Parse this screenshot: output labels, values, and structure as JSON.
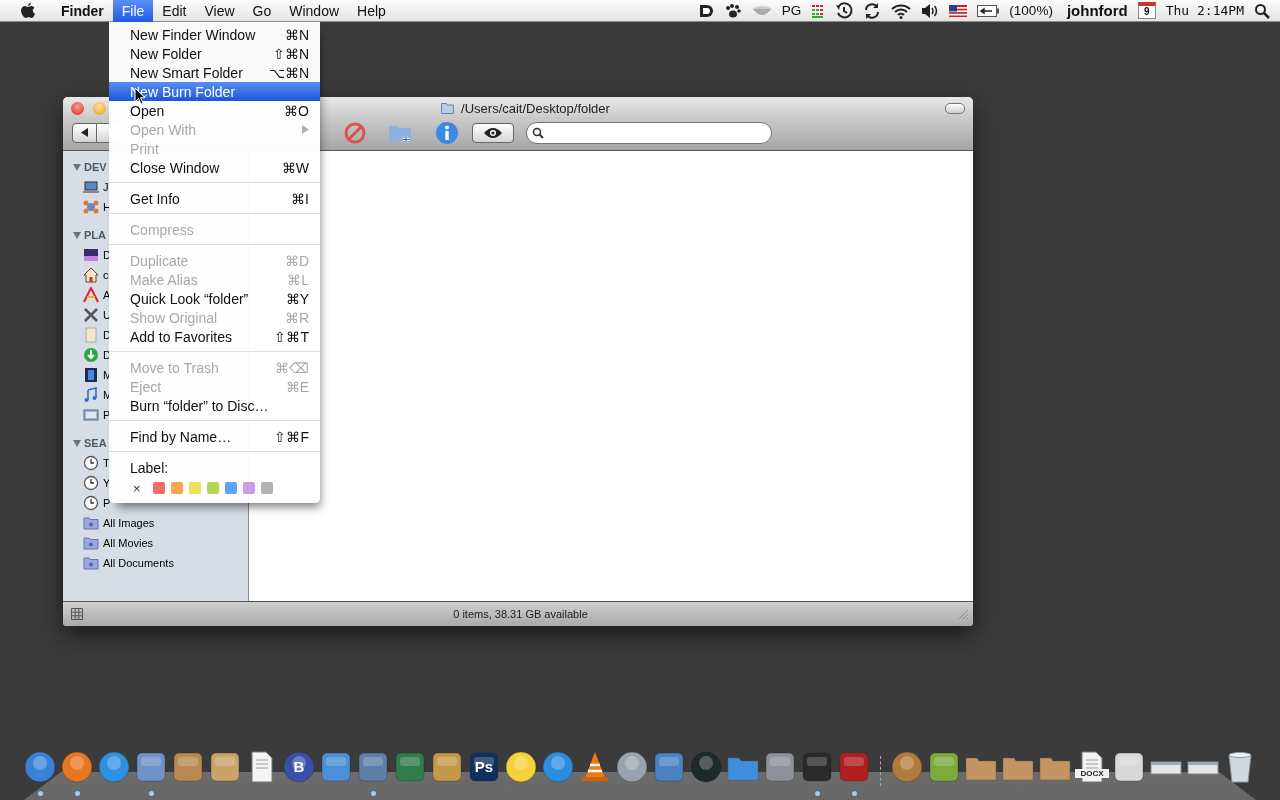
{
  "menubar": {
    "app": "Finder",
    "menus": [
      {
        "label": "File",
        "selected": true
      },
      {
        "label": "Edit",
        "selected": false
      },
      {
        "label": "View",
        "selected": false
      },
      {
        "label": "Go",
        "selected": false
      },
      {
        "label": "Window",
        "selected": false
      },
      {
        "label": "Help",
        "selected": false
      }
    ],
    "status_text": "PG",
    "battery": "(100%)",
    "user": "johnford",
    "calendar_day": "9",
    "clock": "Thu 2:14PM"
  },
  "file_menu": {
    "items": [
      {
        "kind": "item",
        "label": "New Finder Window",
        "shortcut": "⌘N",
        "disabled": false,
        "selected": false
      },
      {
        "kind": "item",
        "label": "New Folder",
        "shortcut": "⇧⌘N",
        "disabled": false,
        "selected": false
      },
      {
        "kind": "item",
        "label": "New Smart Folder",
        "shortcut": "⌥⌘N",
        "disabled": false,
        "selected": false
      },
      {
        "kind": "item",
        "label": "New Burn Folder",
        "disabled": false,
        "selected": true
      },
      {
        "kind": "item",
        "label": "Open",
        "shortcut": "⌘O",
        "disabled": false,
        "selected": false
      },
      {
        "kind": "submenu",
        "label": "Open With",
        "disabled": true,
        "selected": false
      },
      {
        "kind": "item",
        "label": "Print",
        "disabled": true,
        "selected": false
      },
      {
        "kind": "item",
        "label": "Close Window",
        "shortcut": "⌘W",
        "disabled": false,
        "selected": false
      },
      {
        "kind": "separator"
      },
      {
        "kind": "item",
        "label": "Get Info",
        "shortcut": "⌘I",
        "disabled": false,
        "selected": false
      },
      {
        "kind": "separator"
      },
      {
        "kind": "item",
        "label": "Compress",
        "disabled": true,
        "selected": false
      },
      {
        "kind": "separator"
      },
      {
        "kind": "item",
        "label": "Duplicate",
        "shortcut": "⌘D",
        "disabled": true,
        "selected": false
      },
      {
        "kind": "item",
        "label": "Make Alias",
        "shortcut": "⌘L",
        "disabled": true,
        "selected": false
      },
      {
        "kind": "item",
        "label": "Quick Look “folder”",
        "shortcut": "⌘Y",
        "disabled": false,
        "selected": false
      },
      {
        "kind": "item",
        "label": "Show Original",
        "shortcut": "⌘R",
        "disabled": true,
        "selected": false
      },
      {
        "kind": "item",
        "label": "Add to Favorites",
        "shortcut": "⇧⌘T",
        "disabled": false,
        "selected": false
      },
      {
        "kind": "separator"
      },
      {
        "kind": "item",
        "label": "Move to Trash",
        "shortcut": "⌘⌫",
        "disabled": true,
        "selected": false
      },
      {
        "kind": "item",
        "label": "Eject",
        "shortcut": "⌘E",
        "disabled": true,
        "selected": false
      },
      {
        "kind": "item",
        "label": "Burn “folder” to Disc…",
        "disabled": false,
        "selected": false
      },
      {
        "kind": "separator"
      },
      {
        "kind": "item",
        "label": "Find by Name…",
        "shortcut": "⇧⌘F",
        "disabled": false,
        "selected": false
      },
      {
        "kind": "separator"
      },
      {
        "kind": "heading",
        "label": "Label:"
      },
      {
        "kind": "labels",
        "clear": "×",
        "colors": [
          {
            "color": "#f26d6a"
          },
          {
            "color": "#f5a750"
          },
          {
            "color": "#f2de5a"
          },
          {
            "color": "#b1d855"
          },
          {
            "color": "#5ea3f4"
          },
          {
            "color": "#c99be4"
          },
          {
            "color": "#b3b3b3"
          }
        ]
      }
    ]
  },
  "window": {
    "title": "/Users/cait/Desktop/folder",
    "status": "0 items, 38.31 GB available",
    "sidebar": [
      {
        "heading": "DEV",
        "items": [
          {
            "label": "J"
          },
          {
            "label": "H"
          }
        ]
      },
      {
        "heading": "PLA",
        "items": [
          {
            "label": "D"
          },
          {
            "label": "c"
          },
          {
            "label": "A"
          },
          {
            "label": "U"
          },
          {
            "label": "D"
          },
          {
            "label": "D"
          },
          {
            "label": "M"
          },
          {
            "label": "M"
          },
          {
            "label": "P"
          }
        ]
      },
      {
        "heading": "SEA",
        "items": [
          {
            "label": "T"
          },
          {
            "label": "Y"
          },
          {
            "label": "P"
          },
          {
            "label": "All Images"
          },
          {
            "label": "All Movies"
          },
          {
            "label": "All Documents"
          }
        ]
      }
    ]
  },
  "dock": {
    "items": [
      {
        "running": true
      },
      {
        "running": true
      },
      {
        "running": false
      },
      {
        "running": true
      },
      {
        "running": false
      },
      {
        "running": false
      },
      {
        "running": false
      },
      {
        "glyph": "B",
        "running": false
      },
      {
        "running": false
      },
      {
        "running": true
      },
      {
        "running": false
      },
      {
        "running": false
      },
      {
        "glyph": "Ps",
        "running": false
      },
      {
        "running": false
      },
      {
        "running": false
      },
      {
        "running": false
      },
      {
        "running": false
      },
      {
        "running": false
      },
      {
        "running": false
      },
      {
        "running": false
      },
      {
        "running": false
      },
      {
        "running": true
      },
      {
        "running": true
      },
      {
        "running": false
      },
      {
        "running": false
      },
      {
        "running": false
      },
      {
        "running": false
      },
      {
        "running": false
      },
      {
        "glyph": "DOCX",
        "running": false
      },
      {
        "running": false
      },
      {
        "running": false
      },
      {
        "running": false
      },
      {
        "running": false
      }
    ]
  }
}
